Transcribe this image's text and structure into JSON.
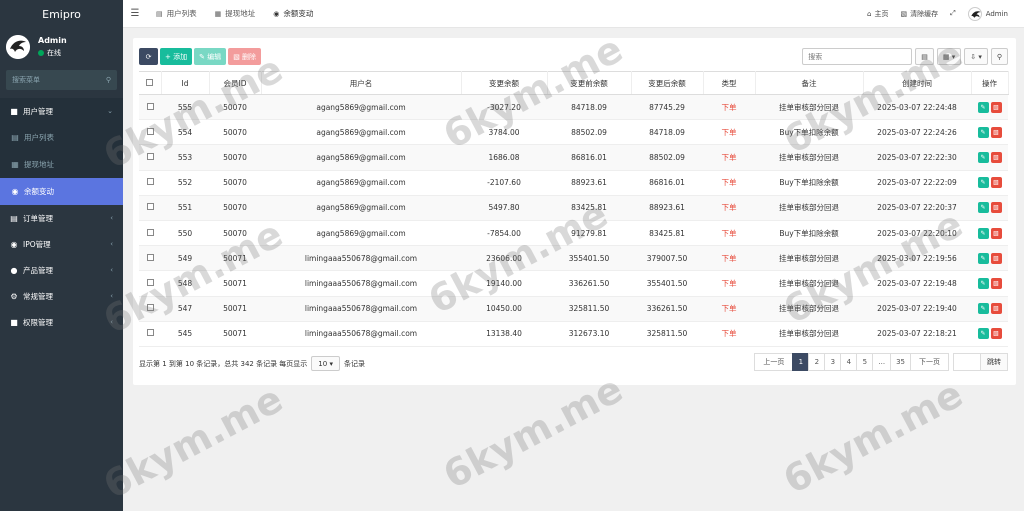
{
  "sidebar": {
    "brand": "Emipro",
    "user": {
      "name": "Admin",
      "status": "在线"
    },
    "search_placeholder": "搜索菜单",
    "menu": [
      {
        "label": "用户管理",
        "open": true
      },
      {
        "label": "用户列表"
      },
      {
        "label": "提现地址"
      },
      {
        "label": "余额变动",
        "active": true
      },
      {
        "label": "订单管理"
      },
      {
        "label": "IPO管理"
      },
      {
        "label": "产品管理"
      },
      {
        "label": "常规管理"
      },
      {
        "label": "权限管理"
      }
    ]
  },
  "header": {
    "tabs": [
      "用户列表",
      "提现地址",
      "余额变动"
    ],
    "right": {
      "home": "主页",
      "clear_cache": "清除缓存",
      "user": "Admin"
    }
  },
  "toolbar": {
    "add": "添加",
    "edit": "编辑",
    "delete": "删除",
    "search_placeholder": "搜索"
  },
  "table": {
    "columns": [
      "Id",
      "会员ID",
      "用户名",
      "变更余额",
      "变更前余额",
      "变更后余额",
      "类型",
      "备注",
      "创建时间",
      "操作"
    ],
    "rows": [
      [
        "555",
        "50070",
        "agang5869@gmail.com",
        "-3027.20",
        "84718.09",
        "87745.29",
        "下单",
        "挂单审核部分回退",
        "2025-03-07 22:24:48"
      ],
      [
        "554",
        "50070",
        "agang5869@gmail.com",
        "3784.00",
        "88502.09",
        "84718.09",
        "下单",
        "Buy下单扣除余额",
        "2025-03-07 22:24:26"
      ],
      [
        "553",
        "50070",
        "agang5869@gmail.com",
        "1686.08",
        "86816.01",
        "88502.09",
        "下单",
        "挂单审核部分回退",
        "2025-03-07 22:22:30"
      ],
      [
        "552",
        "50070",
        "agang5869@gmail.com",
        "-2107.60",
        "88923.61",
        "86816.01",
        "下单",
        "Buy下单扣除余额",
        "2025-03-07 22:22:09"
      ],
      [
        "551",
        "50070",
        "agang5869@gmail.com",
        "5497.80",
        "83425.81",
        "88923.61",
        "下单",
        "挂单审核部分回退",
        "2025-03-07 22:20:37"
      ],
      [
        "550",
        "50070",
        "agang5869@gmail.com",
        "-7854.00",
        "91279.81",
        "83425.81",
        "下单",
        "Buy下单扣除余额",
        "2025-03-07 22:20:10"
      ],
      [
        "549",
        "50071",
        "limingaaa550678@gmail.com",
        "23606.00",
        "355401.50",
        "379007.50",
        "下单",
        "挂单审核部分回退",
        "2025-03-07 22:19:56"
      ],
      [
        "548",
        "50071",
        "limingaaa550678@gmail.com",
        "19140.00",
        "336261.50",
        "355401.50",
        "下单",
        "挂单审核部分回退",
        "2025-03-07 22:19:48"
      ],
      [
        "547",
        "50071",
        "limingaaa550678@gmail.com",
        "10450.00",
        "325811.50",
        "336261.50",
        "下单",
        "挂单审核部分回退",
        "2025-03-07 22:19:40"
      ],
      [
        "545",
        "50071",
        "limingaaa550678@gmail.com",
        "13138.40",
        "312673.10",
        "325811.50",
        "下单",
        "挂单审核部分回退",
        "2025-03-07 22:18:21"
      ]
    ]
  },
  "footer": {
    "info_prefix": "显示第 1 到第 10 条记录，总共 342 条记录 每页显示",
    "page_size": "10",
    "info_suffix": "条记录"
  },
  "pager": {
    "prev": "上一页",
    "pages": [
      "1",
      "2",
      "3",
      "4",
      "5",
      "...",
      "35"
    ],
    "next": "下一页",
    "jump": "跳转"
  },
  "watermark": "6kym.me",
  "colors": {
    "sidebar": "#2b3640",
    "active_menu": "#5b75e0",
    "primary": "#3c4a63",
    "success": "#18bc9c",
    "danger": "#e74c3c"
  }
}
